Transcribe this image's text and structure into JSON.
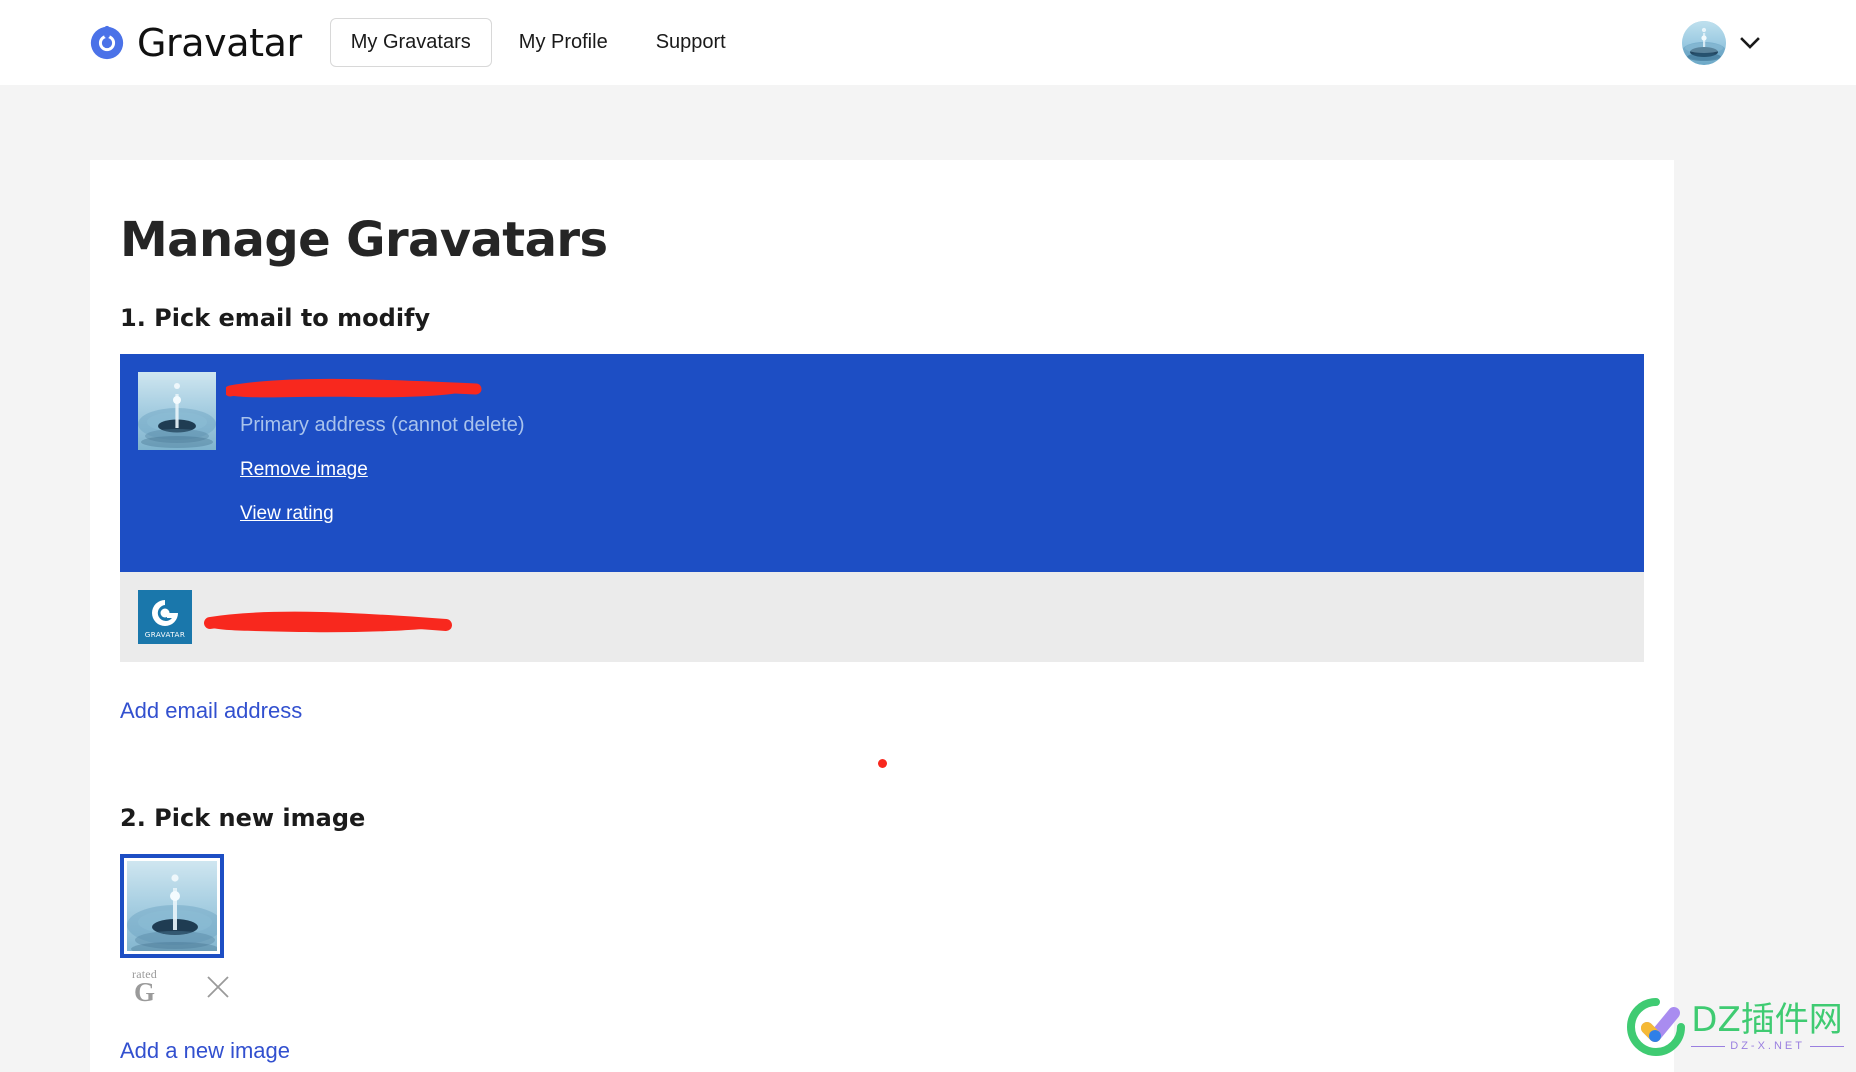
{
  "header": {
    "brand_name": "Gravatar",
    "brand_icon": "gravatar-logo-icon",
    "nav": [
      {
        "label": "My Gravatars",
        "active": true
      },
      {
        "label": "My Profile",
        "active": false
      },
      {
        "label": "Support",
        "active": false
      }
    ],
    "account_avatar_alt": "water-droplet-avatar",
    "account_chevron_icon": "chevron-down-icon"
  },
  "main": {
    "page_title": "Manage Gravatars",
    "step1": {
      "title": "1. Pick email to modify",
      "rows": [
        {
          "email": "",
          "email_redacted": true,
          "subtitle": "Primary address (cannot delete)",
          "links": [
            "Remove image",
            "View rating"
          ],
          "selected": true,
          "thumb": "water-droplet-photo"
        },
        {
          "email": "",
          "email_redacted": true,
          "subtitle": "",
          "links": [],
          "selected": false,
          "thumb": "gravatar-default-logo"
        }
      ],
      "add_email_label": "Add email address"
    },
    "step2": {
      "title": "2. Pick new image",
      "tile_alt": "water-droplet-photo",
      "rating": {
        "word": "rated",
        "letter": "G"
      },
      "delete_icon": "close-x-icon",
      "add_image_label": "Add a new image"
    }
  },
  "watermark": {
    "main": "DZ插件网",
    "sub": "DZ-X.NET"
  },
  "colors": {
    "accent_blue": "#1d4ec4",
    "link_blue": "#3250cf",
    "row_gray": "#ebebeb",
    "page_bg": "#f4f4f4",
    "redaction_red": "#f8281e"
  }
}
